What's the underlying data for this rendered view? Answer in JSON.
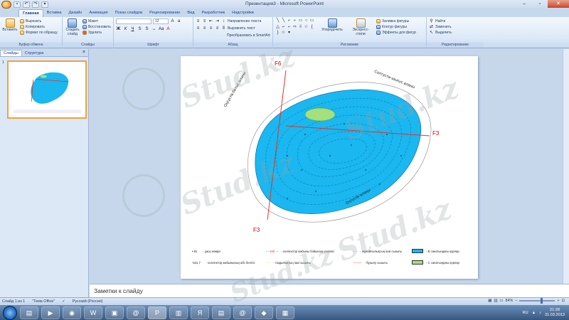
{
  "window": {
    "title": "Презентация3 - Microsoft PowerPoint"
  },
  "tabs": [
    "Главная",
    "Вставка",
    "Дизайн",
    "Анимация",
    "Показ слайдов",
    "Рецензирование",
    "Вид",
    "Разработчик",
    "Надстройки"
  ],
  "ribbon": {
    "clipboard": {
      "label": "Буфер обмена",
      "paste": "Вставить",
      "cut": "Вырезать",
      "copy": "Копировать",
      "format": "Формат по образцу"
    },
    "slides": {
      "label": "Слайды",
      "new": "Создать слайд",
      "layout": "Макет",
      "reset": "Восстановить",
      "delete": "Удалить"
    },
    "font": {
      "label": "Шрифт",
      "size": "12"
    },
    "paragraph": {
      "label": "Абзац",
      "dir": "Направление текста",
      "align": "Выровнять текст",
      "smartart": "Преобразовать в SmartArt"
    },
    "drawing": {
      "label": "Рисование",
      "arrange": "Упорядочить",
      "styles": "Экспресс-стили",
      "fill": "Заливка фигуры",
      "outline": "Контур фигуры",
      "effects": "Эффекты для фигур"
    },
    "editing": {
      "label": "Редактирование",
      "find": "Найти",
      "replace": "Заменить",
      "select": "Выделить"
    }
  },
  "pane": {
    "tab_slides": "Слайды",
    "tab_outline": "Структура",
    "close": "×",
    "slide_num": "1"
  },
  "slide": {
    "labels": {
      "f6": "F6",
      "f3a": "F3",
      "f3b": "F3",
      "nw": "Оңтүстік-батыс аланы",
      "ne": "Солтүстік-шығыс аланы",
      "s": "Оңтүстік алаңы"
    },
    "legend": [
      {
        "sym": "• 91",
        "text": "- ұңғы нөмірі"
      },
      {
        "sym": "-631,7",
        "text": "- коллектор жабынының абс белгісі"
      },
      {
        "sym": "--- 640 ---",
        "text": "- коллектор жабыны бойынша изогипс"
      },
      {
        "sym": "- - -",
        "text": "- газдылықтың ішкі сызығы"
      },
      {
        "sym": "- · -",
        "text": "- мұнайлылықтың ішкі сызығы"
      },
      {
        "sym": "———",
        "text": "- бұзылу сызығы"
      },
      {
        "text": "- В санатындағы қорлар"
      },
      {
        "text": "- С санатындағы қорлар"
      }
    ]
  },
  "notes": {
    "placeholder": "Заметки к слайду"
  },
  "status": {
    "slide": "Слайд 1 из 1",
    "theme": "\"Тема Office\"",
    "lang": "Русский (Россия)",
    "zoom": "84%"
  },
  "tray": {
    "lang": "RU",
    "time": "21:28",
    "date": "31.03.2013"
  },
  "watermark": "Stud.kz",
  "colors": {
    "oil": "#1ab7f0",
    "gas": "#a6e07a",
    "fault": "#e8302a",
    "ribbon": "#dbe8f7"
  }
}
